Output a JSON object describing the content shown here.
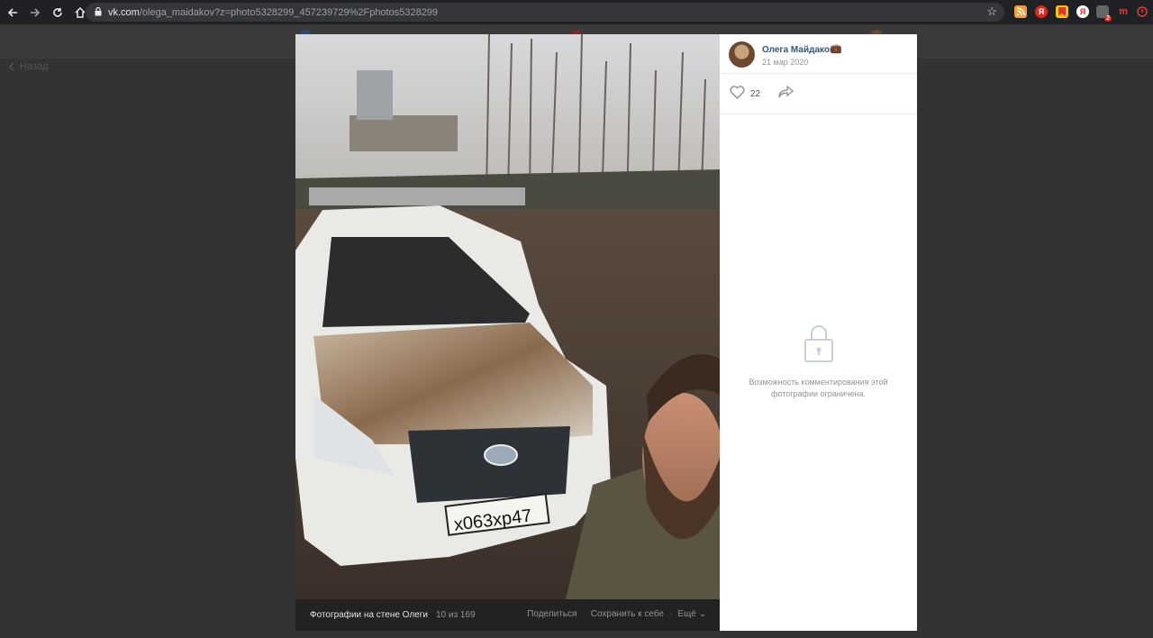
{
  "browser": {
    "url_host": "vk.com",
    "url_path": "/olega_maidakov?z=photo5328299_457239729%2Fphotos5328299",
    "extension_badge": "2"
  },
  "background_page": {
    "back_label": "Назад"
  },
  "viewer": {
    "author_name": "Олега Майдаков",
    "date": "21 мар 2020",
    "likes": "22",
    "comments_locked_text": "Возможность комментирования этой фотографии ограничена.",
    "album_title": "Фотографии на стене Олеги",
    "counter": "10 из 169",
    "actions": {
      "share": "Поделиться",
      "save": "Сохранить к себе",
      "more": "Ещё"
    },
    "photo": {
      "plate_text": "х063хр47"
    }
  },
  "colors": {
    "link": "#2a5885",
    "muted": "#939393",
    "chrome_bg": "#202124",
    "overlay_bg": "#2b2b2b"
  }
}
